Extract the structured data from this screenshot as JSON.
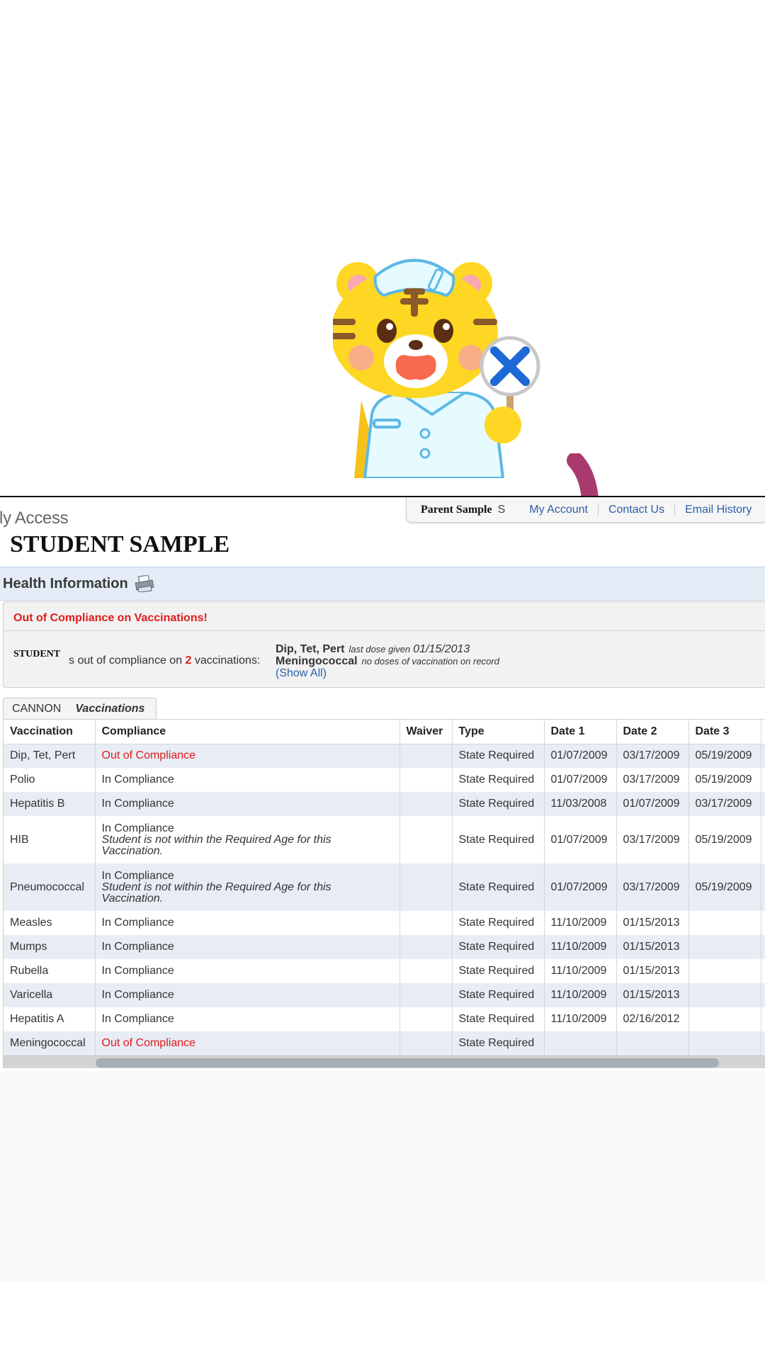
{
  "header": {
    "app_title": "ily Access",
    "student_name": "STUDENT SAMPLE",
    "user_name": "Parent Sample",
    "user_initial": "S",
    "nav_links": [
      "My Account",
      "Contact Us",
      "Email History"
    ]
  },
  "section": {
    "title": "Health Information"
  },
  "alert": {
    "title": "Out of Compliance on Vaccinations!",
    "student": "STUDENT",
    "text_before": "s out of compliance on ",
    "count": "2",
    "text_after": " vaccinations:",
    "items": [
      {
        "name": "Dip, Tet, Pert",
        "note": "last dose given",
        "date": "01/15/2013"
      },
      {
        "name": "Meningococcal",
        "note": "no doses of vaccination on record"
      }
    ],
    "show_all": "(Show All)"
  },
  "tab": {
    "school": "CANNON",
    "label": "Vaccinations"
  },
  "table": {
    "columns": [
      "Vaccination",
      "Compliance",
      "Waiver",
      "Type",
      "Date 1",
      "Date 2",
      "Date 3"
    ],
    "rows": [
      {
        "vaccination": "Dip, Tet, Pert",
        "compliance": "Out of Compliance",
        "note": "",
        "waiver": "",
        "type": "State Required",
        "date1": "01/07/2009",
        "date2": "03/17/2009",
        "date3": "05/19/2009",
        "status": "bad"
      },
      {
        "vaccination": "Polio",
        "compliance": "In Compliance",
        "note": "",
        "waiver": "",
        "type": "State Required",
        "date1": "01/07/2009",
        "date2": "03/17/2009",
        "date3": "05/19/2009",
        "status": "ok"
      },
      {
        "vaccination": "Hepatitis B",
        "compliance": "In Compliance",
        "note": "",
        "waiver": "",
        "type": "State Required",
        "date1": "11/03/2008",
        "date2": "01/07/2009",
        "date3": "03/17/2009",
        "status": "ok"
      },
      {
        "vaccination": "HIB",
        "compliance": "In Compliance",
        "note": "Student is not within the Required Age for this Vaccination.",
        "waiver": "",
        "type": "State Required",
        "date1": "01/07/2009",
        "date2": "03/17/2009",
        "date3": "05/19/2009",
        "status": "ok"
      },
      {
        "vaccination": "Pneumococcal",
        "compliance": "In Compliance",
        "note": "Student is not within the Required Age for this Vaccination.",
        "waiver": "",
        "type": "State Required",
        "date1": "01/07/2009",
        "date2": "03/17/2009",
        "date3": "05/19/2009",
        "status": "ok"
      },
      {
        "vaccination": "Measles",
        "compliance": "In Compliance",
        "note": "",
        "waiver": "",
        "type": "State Required",
        "date1": "11/10/2009",
        "date2": "01/15/2013",
        "date3": "",
        "status": "ok"
      },
      {
        "vaccination": "Mumps",
        "compliance": "In Compliance",
        "note": "",
        "waiver": "",
        "type": "State Required",
        "date1": "11/10/2009",
        "date2": "01/15/2013",
        "date3": "",
        "status": "ok"
      },
      {
        "vaccination": "Rubella",
        "compliance": "In Compliance",
        "note": "",
        "waiver": "",
        "type": "State Required",
        "date1": "11/10/2009",
        "date2": "01/15/2013",
        "date3": "",
        "status": "ok"
      },
      {
        "vaccination": "Varicella",
        "compliance": "In Compliance",
        "note": "",
        "waiver": "",
        "type": "State Required",
        "date1": "11/10/2009",
        "date2": "01/15/2013",
        "date3": "",
        "status": "ok"
      },
      {
        "vaccination": "Hepatitis A",
        "compliance": "In Compliance",
        "note": "",
        "waiver": "",
        "type": "State Required",
        "date1": "11/10/2009",
        "date2": "02/16/2012",
        "date3": "",
        "status": "ok"
      },
      {
        "vaccination": "Meningococcal",
        "compliance": "Out of Compliance",
        "note": "",
        "waiver": "",
        "type": "State Required",
        "date1": "",
        "date2": "",
        "date3": "",
        "status": "bad"
      }
    ]
  },
  "colors": {
    "alert_red": "#e01b1b",
    "link_blue": "#2b5fa8",
    "header_band": "#e3ecf7",
    "row_alt": "#e8ecf4",
    "arrow": "#a83a6e",
    "mascot_yellow": "#fdd723",
    "badge_x_blue": "#1d67d6"
  },
  "icons": {
    "mascot": "tiger-nurse-mascot",
    "arrow": "curved-arrow-down",
    "printer": "printer-icon",
    "badge": "x-mark-badge-icon"
  }
}
